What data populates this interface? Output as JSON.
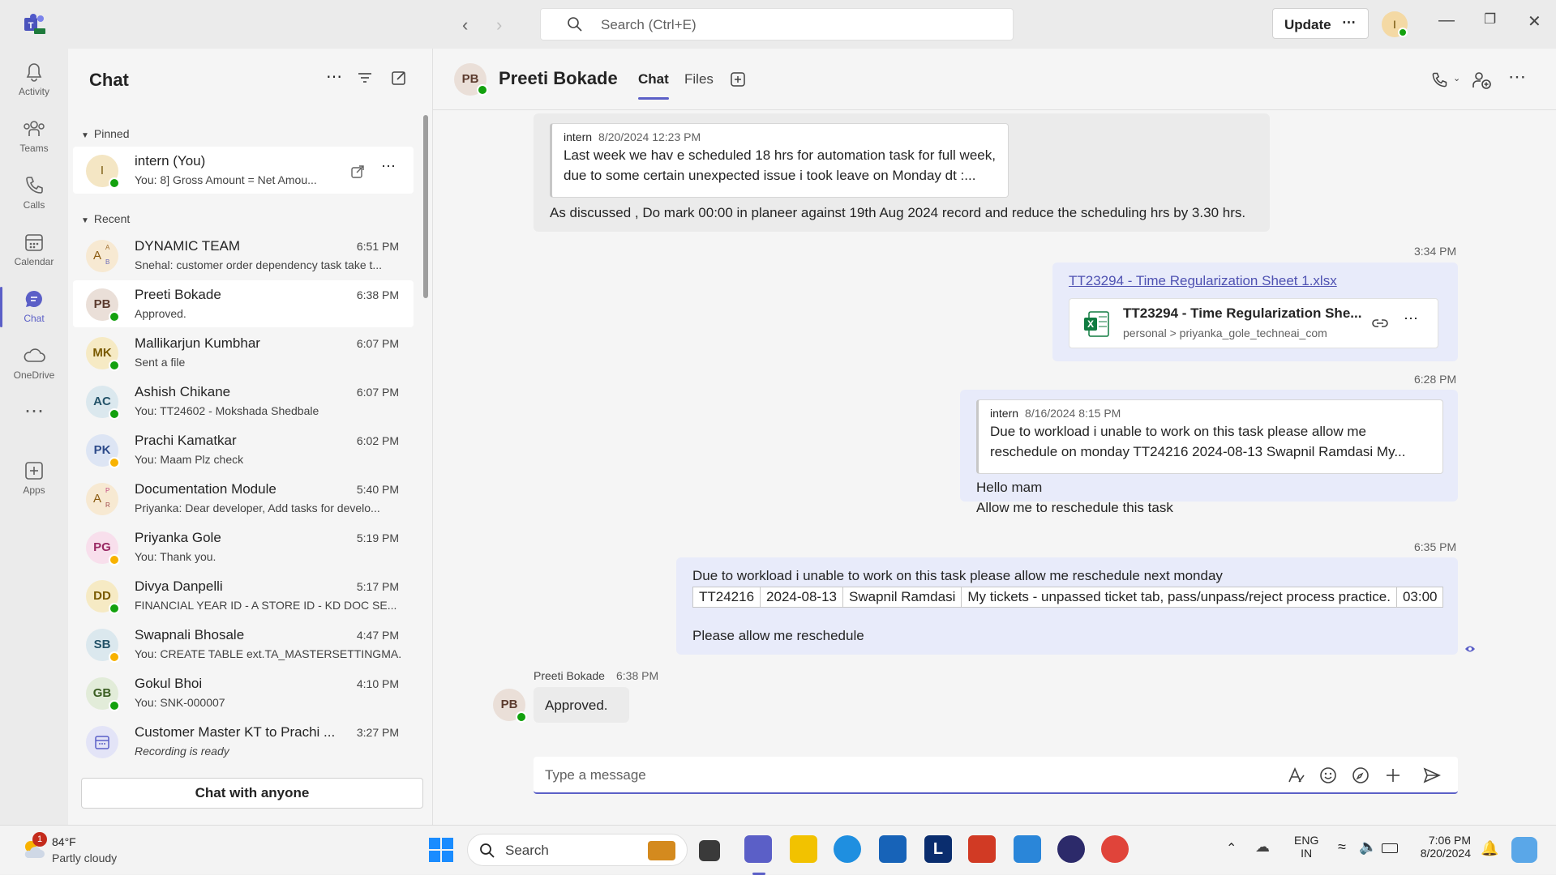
{
  "titlebar": {
    "search_placeholder": "Search (Ctrl+E)",
    "update_label": "Update",
    "user_initial": "I"
  },
  "rail": [
    {
      "label": "Activity",
      "icon": "bell-icon"
    },
    {
      "label": "Teams",
      "icon": "teams-icon"
    },
    {
      "label": "Calls",
      "icon": "phone-icon"
    },
    {
      "label": "Calendar",
      "icon": "calendar-icon"
    },
    {
      "label": "Chat",
      "icon": "chat-icon",
      "active": true
    },
    {
      "label": "OneDrive",
      "icon": "cloud-icon"
    },
    {
      "label": "Apps",
      "icon": "apps-icon"
    }
  ],
  "chatlist": {
    "title": "Chat",
    "pinned_label": "Pinned",
    "recent_label": "Recent",
    "pinned": {
      "initials": "I",
      "name": "intern (You)",
      "preview": "You: 8] Gross Amount = Net Amou..."
    },
    "items": [
      {
        "initials": "A",
        "name": "DYNAMIC TEAM",
        "time": "6:51 PM",
        "preview": "Snehal: customer order dependency task take t..."
      },
      {
        "initials": "PB",
        "name": "Preeti Bokade",
        "time": "6:38 PM",
        "preview": "Approved."
      },
      {
        "initials": "MK",
        "name": "Mallikarjun Kumbhar",
        "time": "6:07 PM",
        "preview": "Sent a file"
      },
      {
        "initials": "AC",
        "name": "Ashish Chikane",
        "time": "6:07 PM",
        "preview": "You: TT24602 - Mokshada Shedbale"
      },
      {
        "initials": "PK",
        "name": "Prachi Kamatkar",
        "time": "6:02 PM",
        "preview": "You: Maam Plz check"
      },
      {
        "initials": "A",
        "name": "Documentation Module",
        "time": "5:40 PM",
        "preview": "Priyanka: Dear developer, Add tasks for develo..."
      },
      {
        "initials": "PG",
        "name": "Priyanka Gole",
        "time": "5:19 PM",
        "preview": "You: Thank you."
      },
      {
        "initials": "DD",
        "name": "Divya Danpelli",
        "time": "5:17 PM",
        "preview": "FINANCIAL YEAR ID - A STORE ID - KD DOC SE..."
      },
      {
        "initials": "SB",
        "name": "Swapnali Bhosale",
        "time": "4:47 PM",
        "preview": "You: CREATE TABLE ext.TA_MASTERSETTINGMA..."
      },
      {
        "initials": "GB",
        "name": "Gokul Bhoi",
        "time": "4:10 PM",
        "preview": "You: SNK-000007"
      },
      {
        "initials": "",
        "name": "Customer Master KT to Prachi ...",
        "time": "3:27 PM",
        "preview": "Recording is ready"
      }
    ],
    "chat_anyone": "Chat with anyone"
  },
  "conversation": {
    "initials": "PB",
    "title": "Preeti Bokade",
    "tabs": [
      "Chat",
      "Files"
    ],
    "msg1": {
      "quote_author": "intern",
      "quote_date": "8/20/2024 12:23 PM",
      "quote_line1": "Last week we hav e scheduled 18 hrs for automation task for full week,",
      "quote_line2": "due to some certain unexpected issue i took leave on Monday dt :...",
      "text": "As discussed , Do mark 00:00 in planeer against 19th Aug 2024 record and reduce the scheduling hrs by 3.30 hrs."
    },
    "msg2": {
      "time": "3:34 PM",
      "link": "TT23294 - Time Regularization Sheet 1.xlsx",
      "file_name": "TT23294 - Time Regularization She...",
      "file_path": "personal > priyanka_gole_techneai_com"
    },
    "msg3": {
      "time": "6:28 PM",
      "quote_author": "intern",
      "quote_date": "8/16/2024 8:15 PM",
      "quote_line1": "Due to workload i unable to work on this task please allow me",
      "quote_line2": "reschedule on monday TT24216 2024-08-13 Swapnil Ramdasi My...",
      "line1": "Hello mam",
      "line2": "Allow me to reschedule this task"
    },
    "msg4": {
      "time": "6:35 PM",
      "line1": "Due to workload i unable to work on this task please allow me reschedule next monday",
      "table": [
        "TT24216",
        "2024-08-13",
        "Swapnil Ramdasi",
        "My tickets - unpassed ticket tab, pass/unpass/reject process practice.",
        "03:00"
      ],
      "line2": "Please allow me reschedule"
    },
    "msg5": {
      "author": "Preeti Bokade",
      "time": "6:38 PM",
      "initials": "PB",
      "text": "Approved."
    },
    "composer_placeholder": "Type a message"
  },
  "taskbar": {
    "weather_temp": "84°F",
    "weather_desc": "Partly cloudy",
    "weather_badge": "1",
    "search_label": "Search",
    "lang1": "ENG",
    "lang2": "IN",
    "clock_time": "7:06 PM",
    "clock_date": "8/20/2024"
  },
  "colors": {
    "accent": "#5b5fc7",
    "available": "#13a10e",
    "away": "#f8b200"
  }
}
